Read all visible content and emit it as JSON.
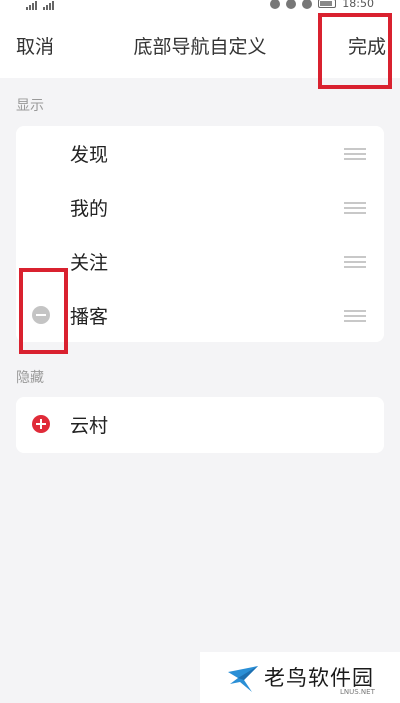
{
  "status_bar": {
    "time": "18:50"
  },
  "header": {
    "cancel_label": "取消",
    "title": "底部导航自定义",
    "done_label": "完成"
  },
  "shown_section": {
    "label": "显示",
    "items": [
      {
        "label": "发现"
      },
      {
        "label": "我的"
      },
      {
        "label": "关注"
      },
      {
        "label": "播客"
      }
    ]
  },
  "hidden_section": {
    "label": "隐藏",
    "items": [
      {
        "label": "云村"
      }
    ]
  },
  "watermark": {
    "brand": "老鸟软件园",
    "domain": "LNUS.NET"
  },
  "colors": {
    "accent_red": "#e02b39",
    "highlight_red": "#d9212f",
    "remove_gray": "#c4c4c4",
    "background": "#f4f4f6"
  },
  "icons": {
    "remove": "minus-circle-icon",
    "add": "plus-circle-icon",
    "drag": "drag-handle-icon"
  }
}
